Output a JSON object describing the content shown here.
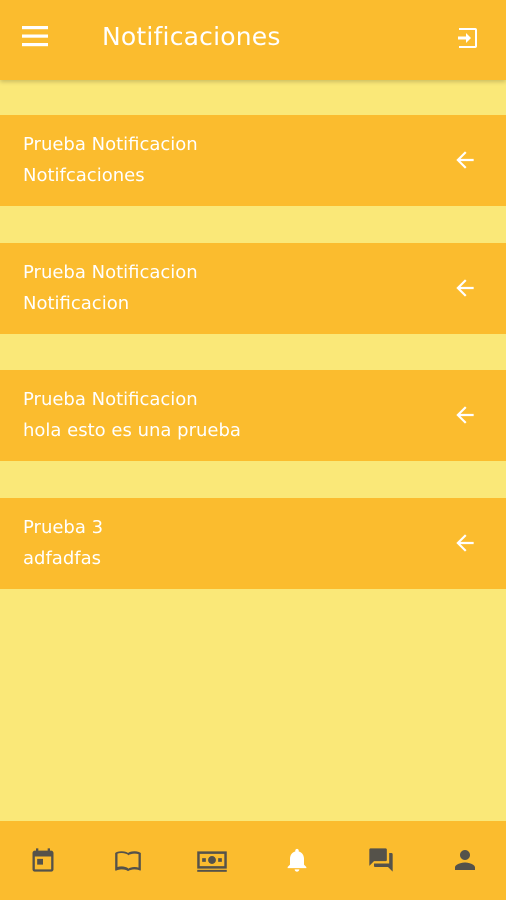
{
  "header": {
    "title": "Notificaciones",
    "menu_icon": "menu-icon",
    "logout_icon": "logout-icon"
  },
  "notifications": [
    {
      "title": "Prueba Notificacion",
      "body": "Notifcaciones"
    },
    {
      "title": "Prueba Notificacion",
      "body": "Notificacion"
    },
    {
      "title": "Prueba Notificacion",
      "body": "hola esto es una prueba"
    },
    {
      "title": "Prueba 3",
      "body": "adfadfas"
    }
  ],
  "bottom_nav": [
    {
      "icon": "calendar-icon",
      "active": false
    },
    {
      "icon": "book-icon",
      "active": false
    },
    {
      "icon": "money-icon",
      "active": false
    },
    {
      "icon": "bell-icon",
      "active": true
    },
    {
      "icon": "chat-icon",
      "active": false
    },
    {
      "icon": "person-icon",
      "active": false
    }
  ],
  "colors": {
    "primary": "#fbbc2e",
    "background": "#fae878",
    "icon_inactive": "#55524a",
    "icon_active": "#ffffff"
  }
}
